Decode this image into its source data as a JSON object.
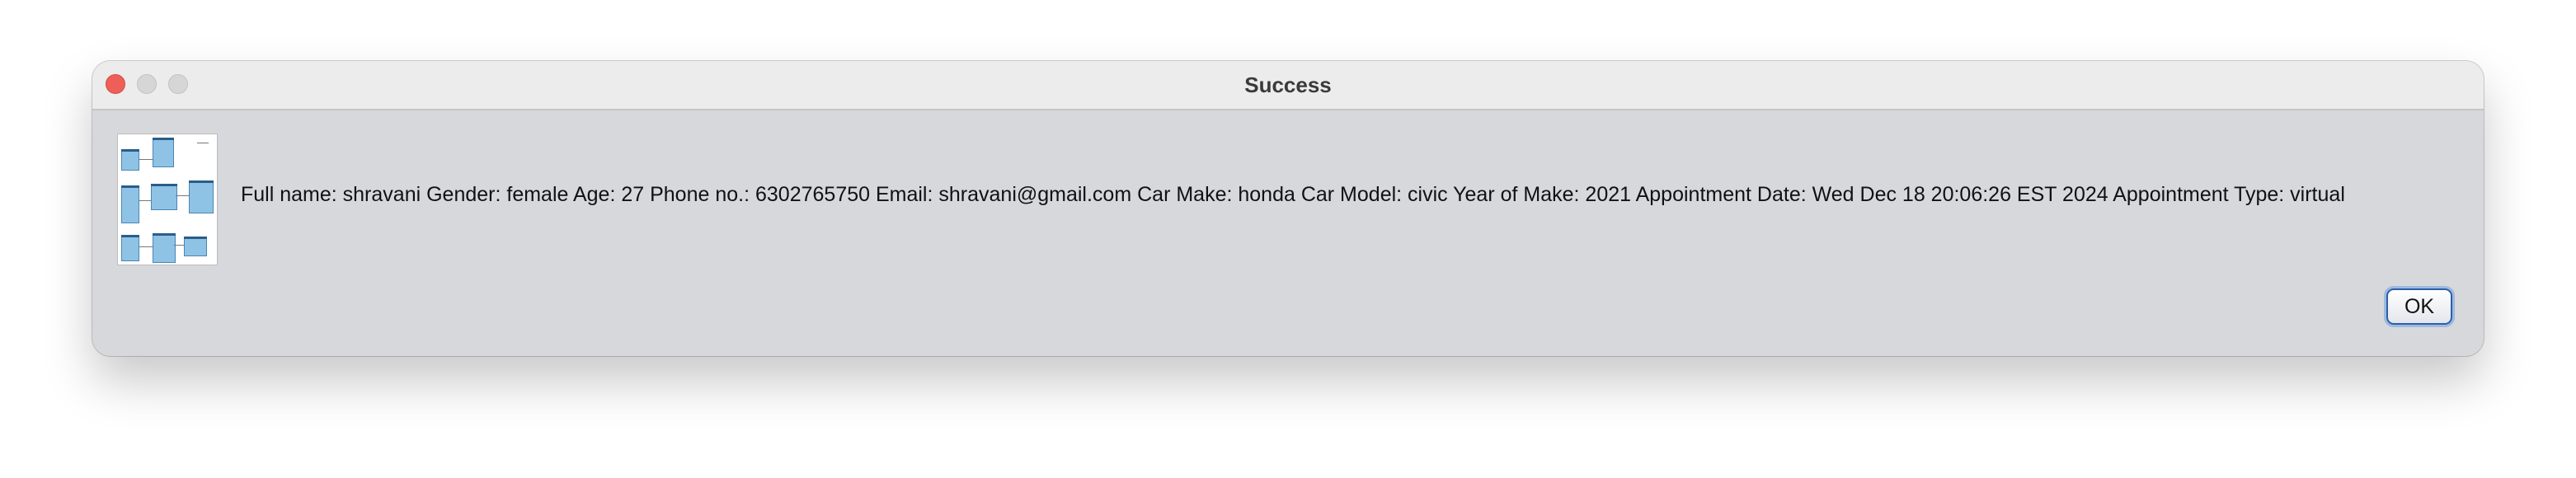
{
  "window": {
    "title": "Success"
  },
  "icon": {
    "name": "diagram-thumbnail-icon"
  },
  "message": {
    "text": "Full name: shravani Gender: female Age: 27 Phone no.: 6302765750 Email: shravani@gmail.com Car Make: honda Car Model: civic Year of Make: 2021 Appointment Date: Wed Dec 18 20:06:26 EST 2024 Appointment Type: virtual"
  },
  "buttons": {
    "ok_label": "OK"
  },
  "colors": {
    "dialog_background": "#d7d8dc",
    "titlebar_background": "#ececec",
    "close_button": "#ee5f58",
    "default_button_border": "#2d5fa8"
  }
}
